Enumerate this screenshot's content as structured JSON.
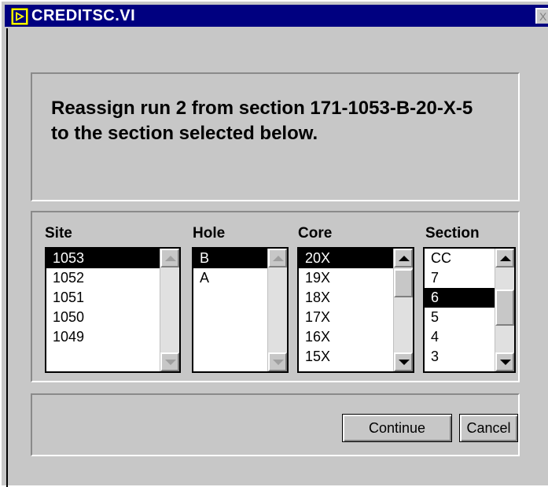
{
  "window": {
    "title": "CREDITSC.VI",
    "close_label": "X"
  },
  "message": "Reassign run 2 from section 171-1053-B-20-X-5 to the section selected below.",
  "lists": {
    "site": {
      "label": "Site",
      "items": [
        "1053",
        "1052",
        "1051",
        "1050",
        "1049"
      ],
      "selected": "1053"
    },
    "hole": {
      "label": "Hole",
      "items": [
        "B",
        "A"
      ],
      "selected": "B"
    },
    "core": {
      "label": "Core",
      "items": [
        "20X",
        "19X",
        "18X",
        "17X",
        "16X",
        "15X"
      ],
      "selected": "20X"
    },
    "section": {
      "label": "Section",
      "items": [
        "CC",
        "7",
        "6",
        "5",
        "4",
        "3"
      ],
      "selected": "6"
    }
  },
  "buttons": {
    "continue_label": "Continue",
    "cancel_label": "Cancel"
  }
}
